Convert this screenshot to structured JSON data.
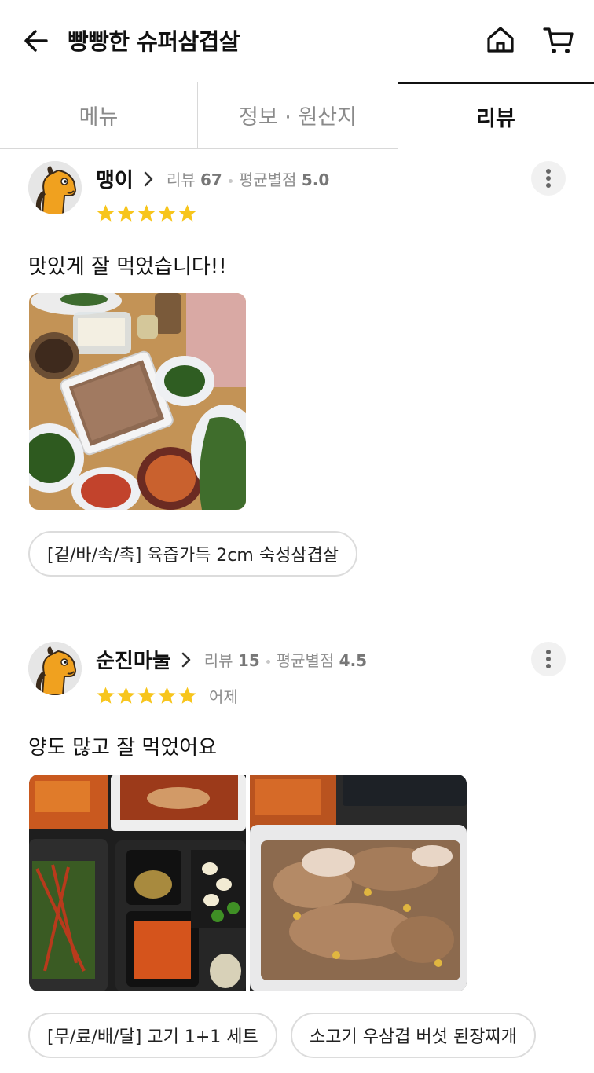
{
  "header": {
    "title": "빵빵한 슈퍼삼겹살",
    "back_icon": "arrow-left-icon",
    "home_icon": "home-icon",
    "cart_icon": "cart-icon"
  },
  "tabs": [
    {
      "label": "메뉴",
      "active": false
    },
    {
      "label": "정보 · 원산지",
      "active": false
    },
    {
      "label": "리뷰",
      "active": true
    }
  ],
  "colors": {
    "star": "#f7c51c",
    "active_tab": "#111111",
    "inactive_tab": "#8a8a8a"
  },
  "reviews": [
    {
      "nickname": "맹이",
      "review_count_label": "리뷰",
      "review_count": "67",
      "avg_rating_label": "평균별점",
      "avg_rating": "5.0",
      "stars": 5,
      "date": "",
      "text": "맛있게 잘 먹었습니다!!",
      "photos": 1,
      "menu_chips": [
        "[겉/바/속/촉] 육즙가득 2cm 숙성삼겹살"
      ]
    },
    {
      "nickname": "순진마눌",
      "review_count_label": "리뷰",
      "review_count": "15",
      "avg_rating_label": "평균별점",
      "avg_rating": "4.5",
      "stars": 5,
      "date": "어제",
      "text": "양도 많고 잘 먹었어요",
      "photos": 2,
      "menu_chips": [
        "[무/료/배/달] 고기 1+1 세트",
        "소고기 우삼겹 버섯 된장찌개"
      ]
    }
  ]
}
